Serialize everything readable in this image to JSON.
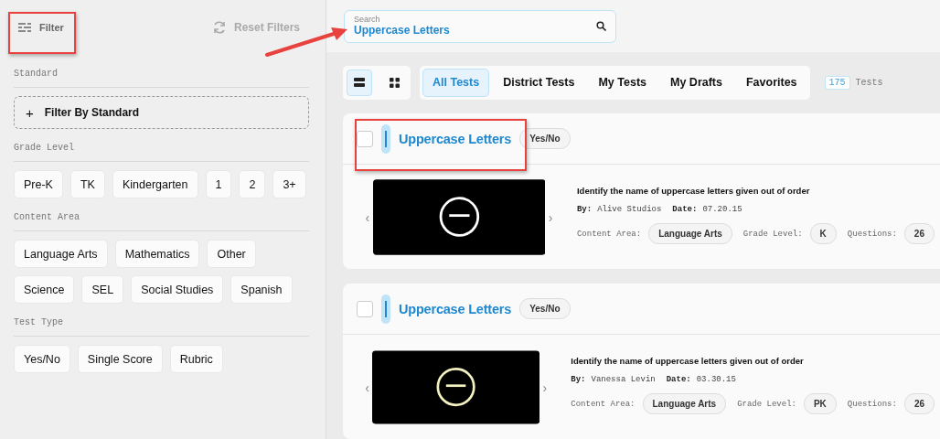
{
  "sidebar": {
    "filter_label": "Filter",
    "reset_label": "Reset Filters",
    "sections": [
      {
        "title": "Standard",
        "kind": "standard",
        "button": "Filter By Standard",
        "plus": "+"
      },
      {
        "title": "Grade Level",
        "kind": "chips",
        "chips": [
          "Pre-K",
          "TK",
          "Kindergarten",
          "1",
          "2",
          "3+"
        ]
      },
      {
        "title": "Content Area",
        "kind": "chips",
        "chips": [
          "Language Arts",
          "Mathematics",
          "Other",
          "Science",
          "SEL",
          "Social Studies",
          "Spanish"
        ]
      },
      {
        "title": "Test Type",
        "kind": "chips",
        "chips": [
          "Yes/No",
          "Single Score",
          "Rubric"
        ]
      }
    ]
  },
  "search": {
    "placeholder": "Search",
    "value": "Uppercase Letters"
  },
  "view_toggle": [
    {
      "kind": "list",
      "selected": true
    },
    {
      "kind": "grid",
      "selected": false
    }
  ],
  "tabs": [
    {
      "label": "All Tests",
      "selected": true
    },
    {
      "label": "District Tests",
      "selected": false
    },
    {
      "label": "My Tests",
      "selected": false
    },
    {
      "label": "My Drafts",
      "selected": false
    },
    {
      "label": "Favorites",
      "selected": false
    }
  ],
  "count": {
    "value": "175",
    "label": "Tests"
  },
  "cards": [
    {
      "title": "Uppercase Letters",
      "type": "Yes/No",
      "checked": false,
      "description": "Identify the name of uppercase letters given out of order",
      "by_label": "By:",
      "author": "Alive Studios",
      "date_label": "Date:",
      "date": "07.20.15",
      "content_label": "Content Area:",
      "content": "Language Arts",
      "grade_label": "Grade Level:",
      "grade": "K",
      "questions_label": "Questions:",
      "questions": "26",
      "prev": "‹",
      "next": "›"
    },
    {
      "title": "Uppercase Letters",
      "type": "Yes/No",
      "checked": false,
      "description": "Identify the name of uppercase letters given out of order",
      "by_label": "By:",
      "author": "Vanessa Levin",
      "date_label": "Date:",
      "date": "03.30.15",
      "content_label": "Content Area:",
      "content": "Language Arts",
      "grade_label": "Grade Level:",
      "grade": "PK",
      "questions_label": "Questions:",
      "questions": "26",
      "prev": "‹",
      "next": "›"
    }
  ]
}
